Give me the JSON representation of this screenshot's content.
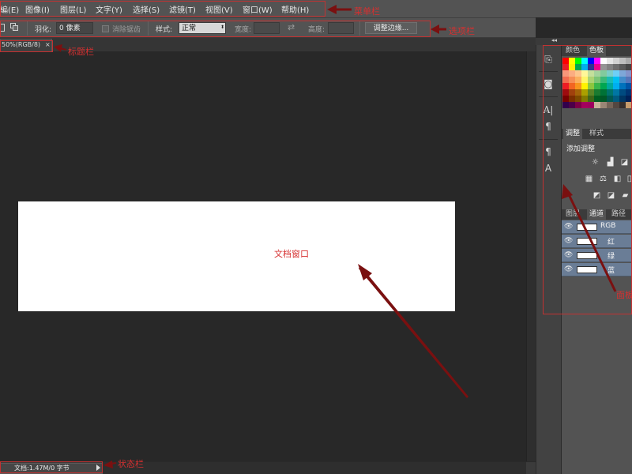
{
  "menubar": {
    "items": [
      "編(E)",
      "图像(I)",
      "图层(L)",
      "文字(Y)",
      "选择(S)",
      "滤镜(T)",
      "视图(V)",
      "窗口(W)",
      "帮助(H)"
    ]
  },
  "options": {
    "feather_label": "羽化:",
    "feather_value": "0 像素",
    "antialias_label": "消除锯齿",
    "style_label": "样式:",
    "style_value": "正常",
    "width_label": "宽度:",
    "height_label": "高度:",
    "refine_edge_label": "调整边缘..."
  },
  "document": {
    "tab_label": "50%(RGB/8)",
    "tab_close": "×"
  },
  "status": {
    "doc_info": "文档:1.47M/0 字节"
  },
  "panel": {
    "collapse_glyph": "◂◂",
    "color_tabs": [
      "颜色",
      "色板"
    ],
    "adjust_tabs": [
      "调整",
      "样式"
    ],
    "add_adjustment_label": "添加调整",
    "layer_tabs": [
      "图层",
      "通道",
      "路径"
    ],
    "channels": [
      "RGB",
      "红",
      "绿",
      "蓝"
    ],
    "swatch_colors": [
      [
        "#ff0000",
        "#ffff00",
        "#00ff00",
        "#00ffff",
        "#0000ff",
        "#ff00ff",
        "#ffffff",
        "#e6e6e6",
        "#d2d2d2",
        "#bebebe",
        "#aaaaaa"
      ],
      [
        "#ed1c24",
        "#fff200",
        "#00a651",
        "#00aeef",
        "#2e3192",
        "#ec008c",
        "#959595",
        "#828282",
        "#6e6e6e",
        "#5a5a5a",
        "#464646"
      ],
      [
        "#f7977a",
        "#fbad82",
        "#fdc68c",
        "#fff799",
        "#c4df9b",
        "#a3d39c",
        "#82ca9d",
        "#7bcdc8",
        "#6ecff6",
        "#7ea7d8",
        "#8493ca"
      ],
      [
        "#f26c4f",
        "#f68e56",
        "#fbaf5d",
        "#fff568",
        "#acd373",
        "#7cc576",
        "#3bb878",
        "#1abbb4",
        "#00bff3",
        "#438cca",
        "#5574b9"
      ],
      [
        "#ed1c24",
        "#f26522",
        "#f7941d",
        "#fff200",
        "#8dc63f",
        "#39b54a",
        "#00a651",
        "#00a99d",
        "#00aeef",
        "#0072bc",
        "#0054a6"
      ],
      [
        "#9e0b0f",
        "#a0410d",
        "#a36209",
        "#aba000",
        "#598527",
        "#1a7b30",
        "#007236",
        "#00746b",
        "#0076a3",
        "#004b80",
        "#003471"
      ],
      [
        "#790000",
        "#7b2e00",
        "#7d4900",
        "#827b00",
        "#406618",
        "#005e20",
        "#005826",
        "#005952",
        "#005b7f",
        "#003663",
        "#002157"
      ],
      [
        "#32004b",
        "#4b0049",
        "#7b0046",
        "#a3005d",
        "#9e005d",
        "#c7b299",
        "#998675",
        "#736357",
        "#534741",
        "#362f2d",
        "#c69c6d"
      ]
    ]
  },
  "annotations": {
    "menubar_label": "菜单栏",
    "options_label": "选项栏",
    "title_label": "标题栏",
    "document_label": "文档窗口",
    "status_label": "状态栏",
    "panel_label": "面板",
    "color": "#c23232",
    "arrow_color": "#7a1010"
  }
}
